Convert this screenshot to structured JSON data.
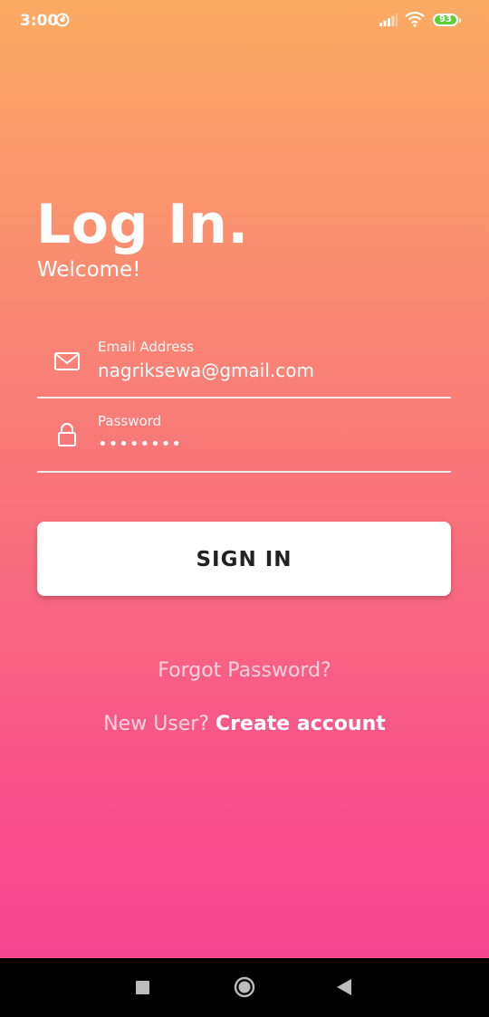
{
  "status_bar": {
    "time": "3:00",
    "battery_level": "93",
    "icons": [
      "sync-icon",
      "signal-icon",
      "wifi-icon",
      "battery-icon"
    ]
  },
  "header": {
    "title": "Log In.",
    "subtitle": "Welcome!"
  },
  "form": {
    "email": {
      "label": "Email Address",
      "value": "nagriksewa@gmail.com",
      "icon": "mail-icon"
    },
    "password": {
      "label": "Password",
      "value": "••••••••",
      "icon": "lock-icon"
    },
    "submit_label": "SIGN IN"
  },
  "links": {
    "forgot_password": "Forgot Password?",
    "new_user_prompt": "New User?",
    "create_account": "Create account"
  },
  "colors": {
    "gradient_top": "#fbab63",
    "gradient_bottom": "#f7448f",
    "battery_green": "#5fcf35"
  },
  "nav_bar": {
    "icons": [
      "recents-icon",
      "home-icon",
      "back-icon"
    ]
  }
}
